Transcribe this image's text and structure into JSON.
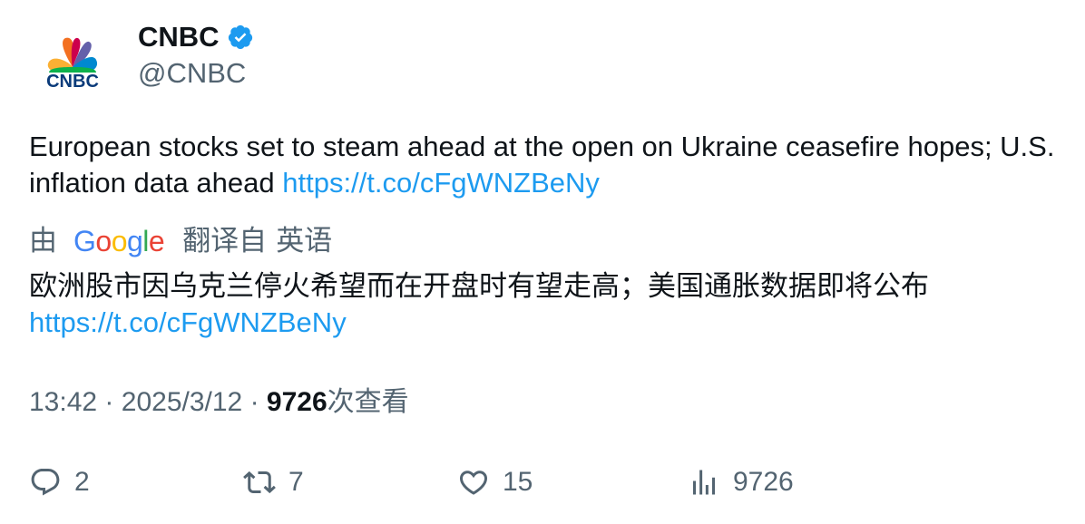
{
  "author": {
    "name": "CNBC",
    "handle": "@CNBC",
    "avatar_logo_text": "CNBC",
    "verified_icon": "verified-badge-icon",
    "verified_color": "#1d9bf0"
  },
  "tweet": {
    "text": "European stocks set to steam ahead at the open on Ukraine ceasefire hopes; U.S. inflation data ahead ",
    "link": "https://t.co/cFgWNZBeNy"
  },
  "translation": {
    "prefix": "由",
    "provider_letters": [
      "G",
      "o",
      "o",
      "g",
      "l",
      "e"
    ],
    "translated_from": "翻译自",
    "source_language": "英语",
    "text": "欧洲股市因乌克兰停火希望而在开盘时有望走高；美国通胀数据即将公布",
    "link": "https://t.co/cFgWNZBeNy"
  },
  "meta": {
    "time": "13:42",
    "separator": "·",
    "date": "2025/3/12",
    "views_count": "9726",
    "views_label": "次查看"
  },
  "actions": {
    "replies": "2",
    "retweets": "7",
    "likes": "15",
    "views": "9726"
  },
  "colors": {
    "text_primary": "#0f1419",
    "text_secondary": "#536471",
    "link": "#1d9bf0"
  }
}
